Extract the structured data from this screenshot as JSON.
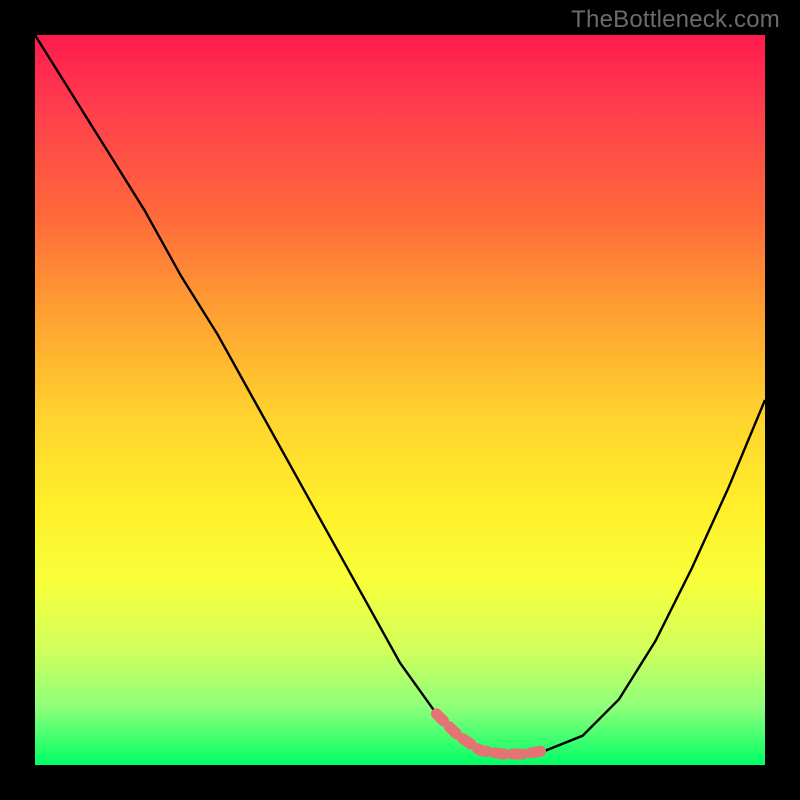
{
  "attribution": "TheBottleneck.com",
  "colors": {
    "frame_bg": "#000000",
    "gradient_top": "#ff1a4d",
    "gradient_bottom": "#00ff66",
    "curve_stroke": "#000000",
    "highlight_stroke": "#e57373"
  },
  "chart_data": {
    "type": "line",
    "title": "",
    "xlabel": "",
    "ylabel": "",
    "xlim": [
      0,
      100
    ],
    "ylim": [
      0,
      100
    ],
    "series": [
      {
        "name": "bottleneck-curve",
        "x": [
          0,
          5,
          10,
          15,
          20,
          25,
          30,
          35,
          40,
          45,
          50,
          55,
          58,
          61,
          64,
          67,
          70,
          75,
          80,
          85,
          90,
          95,
          100
        ],
        "values": [
          100,
          92,
          84,
          76,
          67,
          59,
          50,
          41,
          32,
          23,
          14,
          7,
          4,
          2,
          1.5,
          1.5,
          2,
          4,
          9,
          17,
          27,
          38,
          50
        ]
      },
      {
        "name": "optimal-range-highlight",
        "x": [
          55,
          58,
          61,
          64,
          67,
          70
        ],
        "values": [
          7,
          4,
          2,
          1.5,
          1.5,
          2
        ]
      }
    ],
    "annotations": []
  }
}
